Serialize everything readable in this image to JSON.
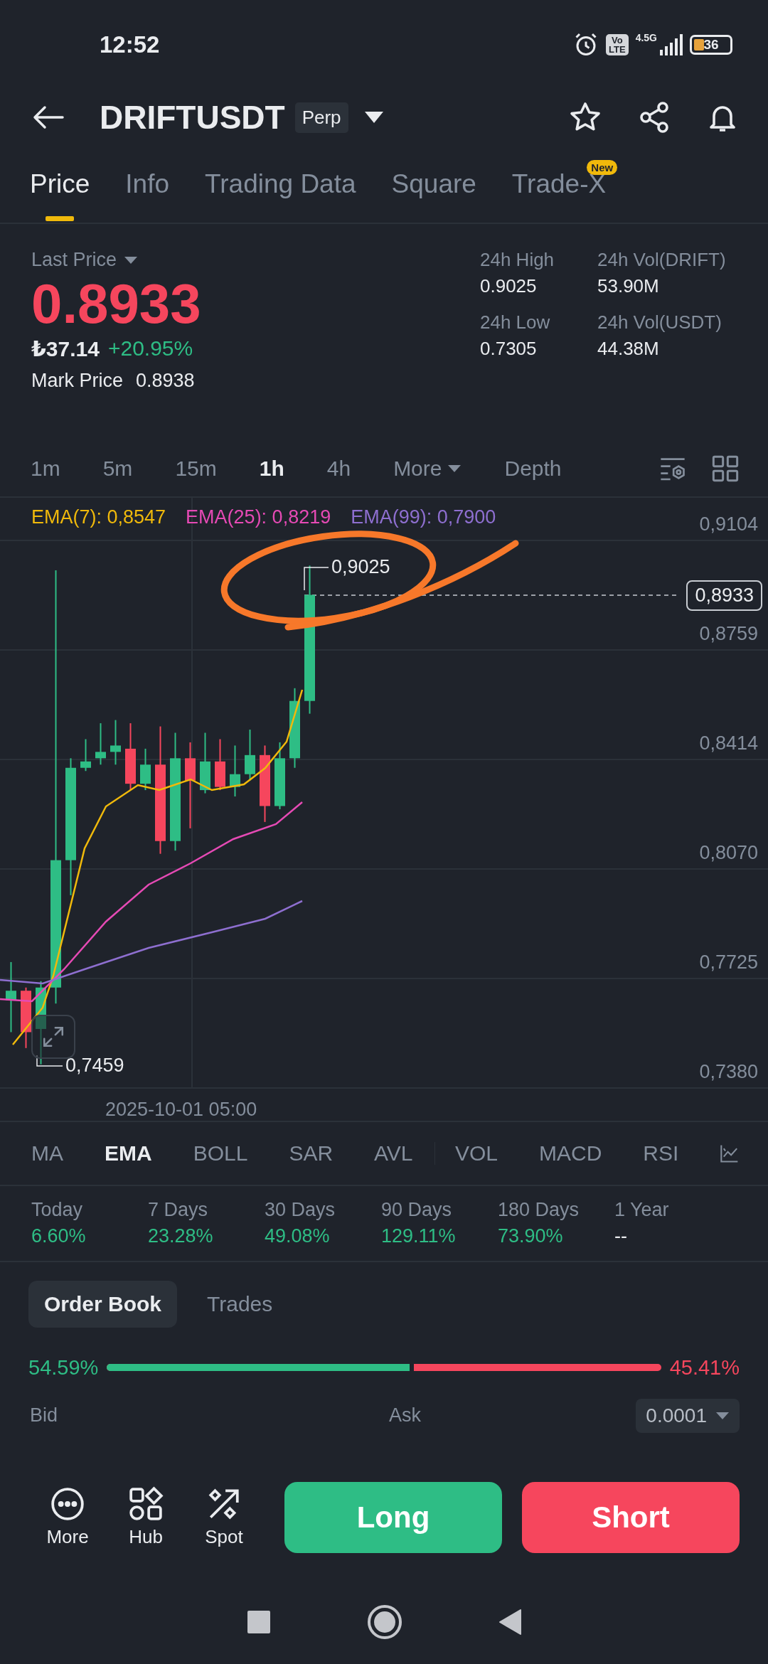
{
  "status_bar": {
    "time": "12:52",
    "volte_top": "Vo",
    "volte_bottom": "LTE",
    "network": "4.5G",
    "battery": "36"
  },
  "header": {
    "symbol": "DRIFTUSDT",
    "badge": "Perp"
  },
  "tabs": [
    {
      "label": "Price",
      "selected": true
    },
    {
      "label": "Info",
      "selected": false
    },
    {
      "label": "Trading Data",
      "selected": false
    },
    {
      "label": "Square",
      "selected": false
    },
    {
      "label": "Trade-X",
      "selected": false,
      "badge": "New"
    }
  ],
  "price": {
    "label": "Last Price",
    "last": "0.8933",
    "fiat": "₺37.14",
    "change": "+20.95%",
    "mark_label": "Mark Price",
    "mark": "0.8938"
  },
  "stats": [
    {
      "label": "24h High",
      "value": "0.9025"
    },
    {
      "label": "24h Vol(DRIFT)",
      "value": "53.90M"
    },
    {
      "label": "24h Low",
      "value": "0.7305"
    },
    {
      "label": "24h Vol(USDT)",
      "value": "44.38M"
    }
  ],
  "intervals": [
    {
      "label": "1m",
      "selected": false,
      "kind": "plain"
    },
    {
      "label": "5m",
      "selected": false,
      "kind": "plain"
    },
    {
      "label": "15m",
      "selected": false,
      "kind": "plain"
    },
    {
      "label": "1h",
      "selected": true,
      "kind": "plain"
    },
    {
      "label": "4h",
      "selected": false,
      "kind": "plain"
    },
    {
      "label": "More",
      "selected": false,
      "kind": "dropdown"
    },
    {
      "label": "Depth",
      "selected": false,
      "kind": "plain"
    }
  ],
  "chart": {
    "legend": [
      {
        "label": "EMA(7): 0,8547",
        "color": "#f0b90b"
      },
      {
        "label": "EMA(25): 0,8219",
        "color": "#e64ab5"
      },
      {
        "label": "EMA(99): 0,7900",
        "color": "#8e6fd0"
      }
    ],
    "price_ticks": [
      "0,9104",
      "0,8759",
      "0,8414",
      "0,8070",
      "0,7725",
      "0,7380"
    ],
    "current_price": "0,8933",
    "high_label": "0,9025",
    "low_label": "0,7459",
    "time_label": "2025-10-01 05:00"
  },
  "main_indicators": [
    {
      "label": "MA",
      "selected": false
    },
    {
      "label": "EMA",
      "selected": true
    },
    {
      "label": "BOLL",
      "selected": false
    },
    {
      "label": "SAR",
      "selected": false
    },
    {
      "label": "AVL",
      "selected": false
    }
  ],
  "sub_indicators": [
    {
      "label": "VOL",
      "selected": false
    },
    {
      "label": "MACD",
      "selected": false
    },
    {
      "label": "RSI",
      "selected": false
    }
  ],
  "performance": [
    {
      "label": "Today",
      "value": "6.60%",
      "color": "#2ebd85"
    },
    {
      "label": "7 Days",
      "value": "23.28%",
      "color": "#2ebd85"
    },
    {
      "label": "30 Days",
      "value": "49.08%",
      "color": "#2ebd85"
    },
    {
      "label": "90 Days",
      "value": "129.11%",
      "color": "#2ebd85"
    },
    {
      "label": "180 Days",
      "value": "73.90%",
      "color": "#2ebd85"
    },
    {
      "label": "1 Year",
      "value": "--",
      "color": "#eaecef"
    }
  ],
  "book_tabs": [
    {
      "label": "Order Book",
      "selected": true
    },
    {
      "label": "Trades",
      "selected": false
    }
  ],
  "ratio": {
    "bid": "54.59%",
    "ask": "45.41%",
    "level": 0.5459
  },
  "book_header": {
    "bid": "Bid",
    "ask": "Ask",
    "precision": "0.0001"
  },
  "bottom_actions": [
    {
      "label": "More",
      "kind": "more"
    },
    {
      "label": "Hub",
      "kind": "hub"
    },
    {
      "label": "Spot",
      "kind": "spot"
    }
  ],
  "trade_buttons": {
    "long": "Long",
    "short": "Short"
  }
}
